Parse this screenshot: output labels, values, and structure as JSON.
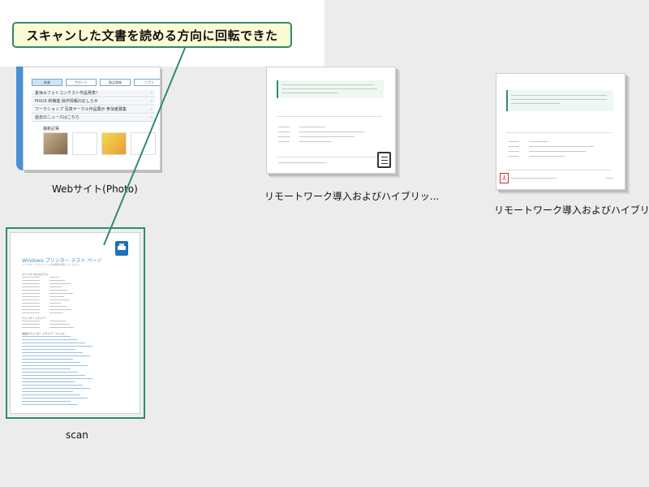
{
  "callout": {
    "text": "スキャンした文書を読める方向に回転できた"
  },
  "files": [
    {
      "name": "Webサイト(Photo)"
    },
    {
      "name": "リモートワーク導入およびハイブリッ..."
    },
    {
      "name": "リモートワーク導入およびハイブリッ..."
    },
    {
      "name": "scan"
    }
  ],
  "web_thumb": {
    "tabs": [
      "新着",
      "サポート",
      "製品情報",
      "ソフト"
    ],
    "bars": [
      "夏休みフォトコンテスト作品発表！",
      "PIXUS 新機能 操作情報のおしらせ",
      "ワークショップ 写真サークル作品展示 参加者募集",
      "過去のニュースはこちら"
    ],
    "section": "最新記事",
    "images": [
      "photo-1",
      "photo-2",
      "photo-3",
      "photo-4"
    ]
  },
  "scan_doc": {
    "title": "Windows プリンター テスト ページ",
    "subtitle": "プリンター テスト ページの詳細を参照してください",
    "headings": [
      "プリンターのプロパティ",
      "プリンター ドライバー",
      "追加のプリンター ドライバー ファイル"
    ]
  },
  "colors": {
    "accent": "#2e8b6e",
    "callout_bg": "#fdfbd6",
    "pdf_red": "#d42b2b"
  },
  "icons": {
    "note": "note-icon",
    "pdf": "pdf-icon",
    "printer": "printer-icon"
  }
}
